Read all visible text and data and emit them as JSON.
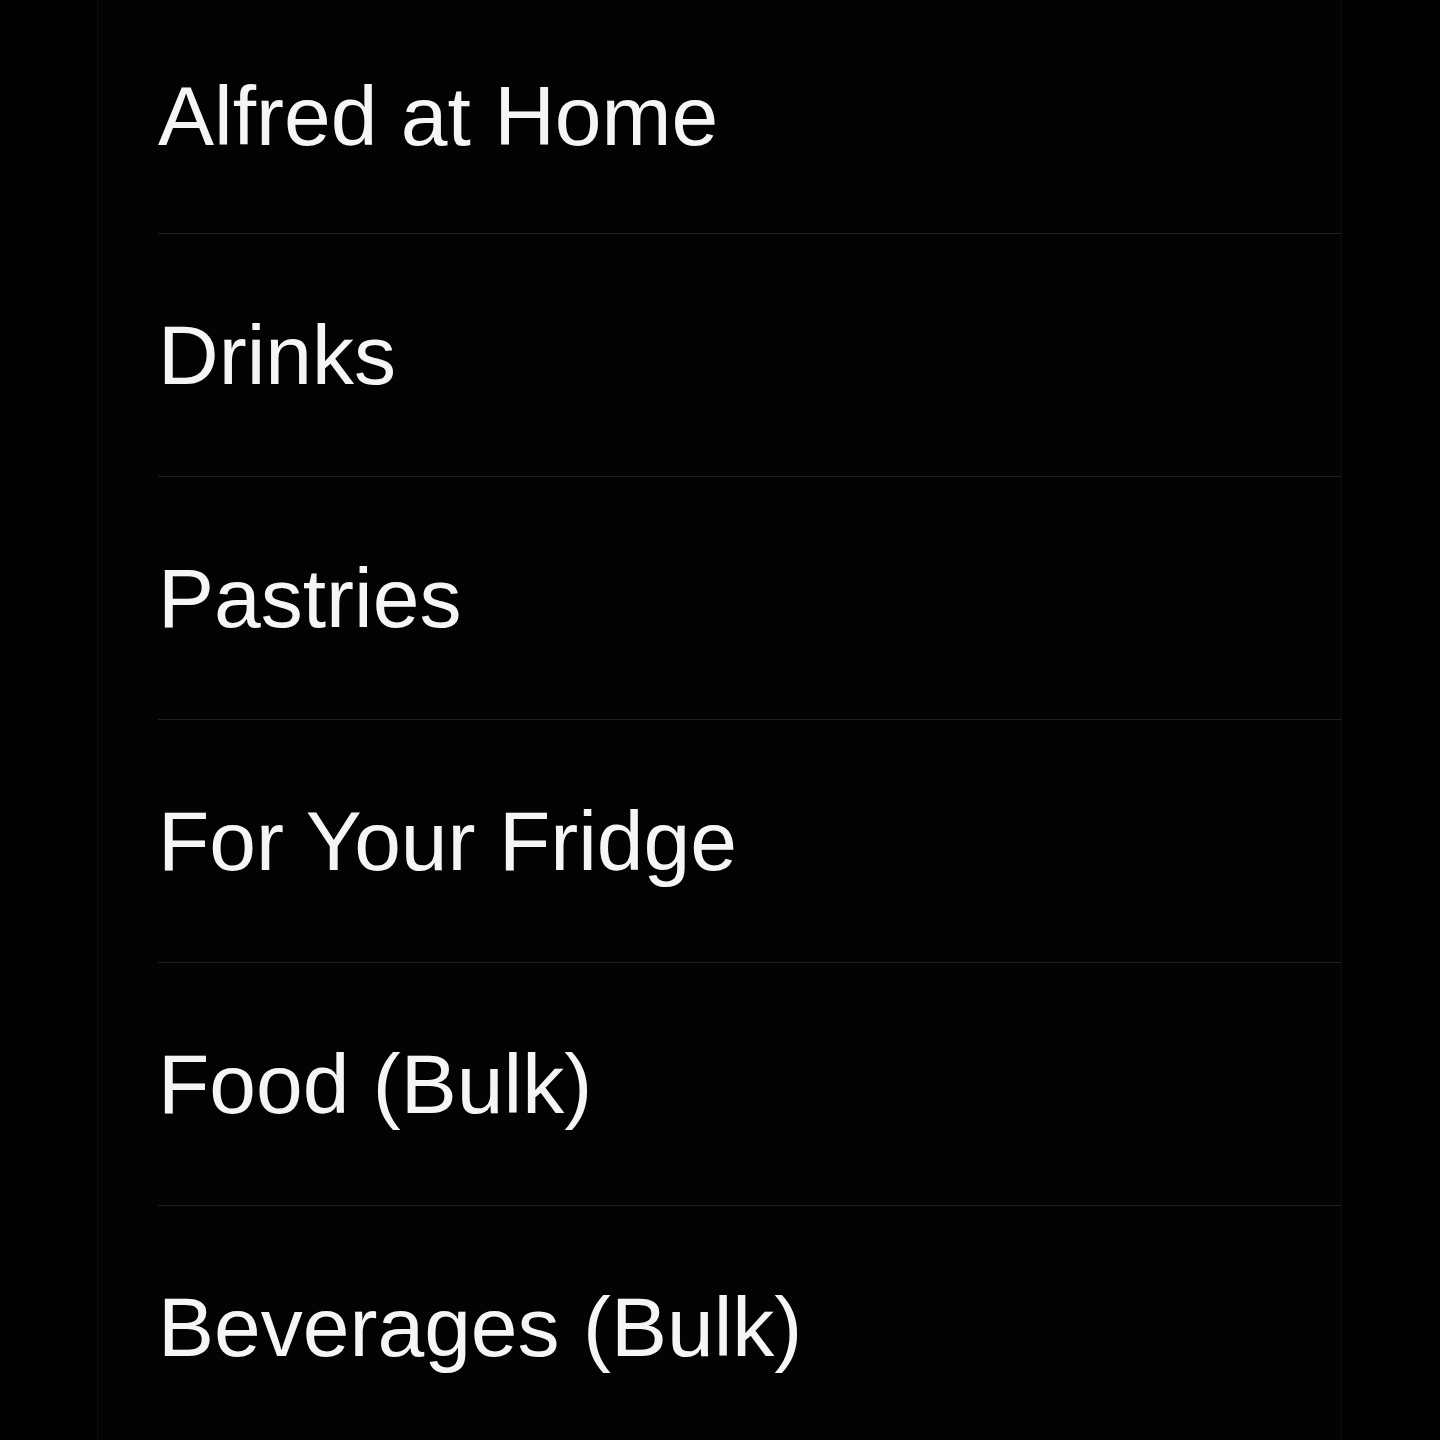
{
  "list": {
    "items": [
      {
        "label": "Alfred at Home"
      },
      {
        "label": "Drinks"
      },
      {
        "label": "Pastries"
      },
      {
        "label": "For Your Fridge"
      },
      {
        "label": "Food (Bulk)"
      },
      {
        "label": "Beverages (Bulk)"
      }
    ]
  }
}
